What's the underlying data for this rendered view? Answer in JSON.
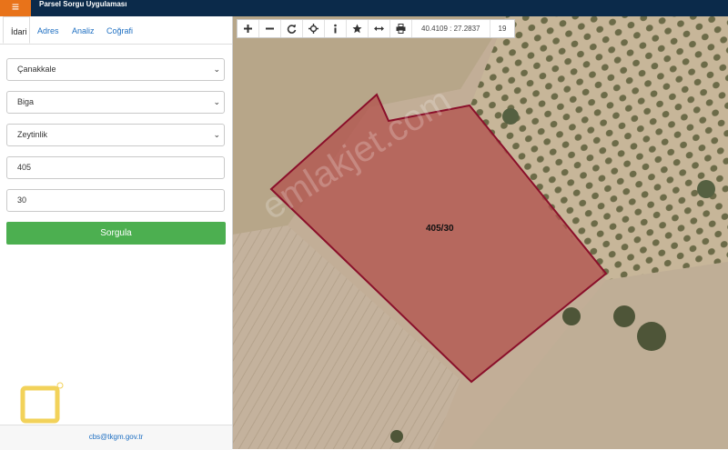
{
  "header": {
    "title": "Parsel Sorgu Uygulaması",
    "menu_icon": "≡"
  },
  "sidebar": {
    "tabs": [
      {
        "label": "İdari",
        "active": true
      },
      {
        "label": "Adres"
      },
      {
        "label": "Analiz"
      },
      {
        "label": "Coğrafi"
      }
    ],
    "province": "Çanakkale",
    "district": "Biga",
    "neighborhood": "Zeytinlik",
    "block_no": "405",
    "parcel_no": "30",
    "query_button": "Sorgula",
    "footer_email": "cbs@tkgm.gov.tr"
  },
  "map": {
    "coordinates": "40.4109 : 27.2837",
    "zoom_level": "19",
    "parcel_label": "405/30",
    "watermark": "emlakjet.com",
    "parcel_color": "#8a0f2a",
    "tools": [
      "plus-icon",
      "minus-icon",
      "refresh-icon",
      "crosshair-icon",
      "info-icon",
      "star-icon",
      "measure-icon",
      "print-icon"
    ]
  }
}
